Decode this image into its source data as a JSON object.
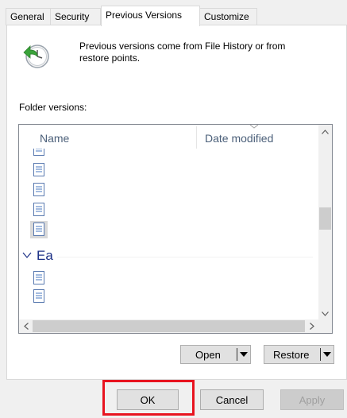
{
  "tabs": [
    {
      "label": "General",
      "active": false
    },
    {
      "label": "Security",
      "active": false
    },
    {
      "label": "Previous Versions",
      "active": true
    },
    {
      "label": "Customize",
      "active": false
    }
  ],
  "info": {
    "icon": "file-history-clock-icon",
    "line1": "Previous versions come from File History or from",
    "line2": "restore points."
  },
  "folder_versions_label": "Folder versions:",
  "list": {
    "columns": [
      "Name",
      "Date modified"
    ],
    "group_label": "Ea",
    "file_icon": "document-icon"
  },
  "actions": {
    "open_label": "Open",
    "restore_label": "Restore"
  },
  "footer": {
    "ok_label": "OK",
    "cancel_label": "Cancel",
    "apply_label": "Apply"
  },
  "colors": {
    "highlight": "#e8131f",
    "group_text": "#1e3287",
    "header_text": "#4c607a"
  }
}
